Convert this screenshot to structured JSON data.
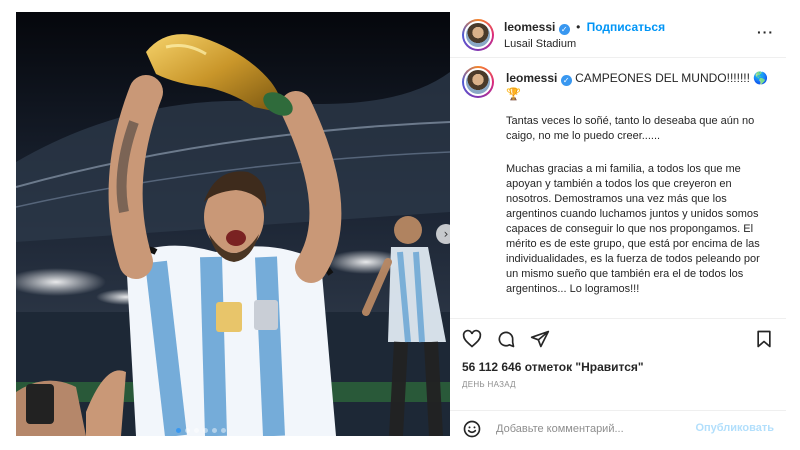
{
  "post": {
    "username": "leomessi",
    "follow_label": "Подписаться",
    "separator": "•",
    "location": "Lusail Stadium",
    "more_icon": "more-horizontal-icon",
    "verified_glyph": "✓"
  },
  "caption": {
    "username": "leomessi",
    "first_line": "CAMPEONES DEL MUNDO!!!!!!! 🌎🏆",
    "paragraph_1": "Tantas veces lo soñé, tanto lo deseaba que aún no caigo, no me lo puedo creer......",
    "paragraph_2": "Muchas gracias a mi familia, a todos los que me apoyan y también a todos los que creyeron en nosotros. Demostramos una vez más que los argentinos cuando luchamos juntos y unidos somos capaces de conseguir lo que nos propongamos. El mérito es de este grupo, que está por encima de las individualidades, es la fuerza de todos peleando por un mismo sueño que también era el de todos los argentinos... Lo logramos!!!"
  },
  "actions": {
    "like_icon": "heart-icon",
    "comment_icon": "comment-icon",
    "share_icon": "paper-plane-icon",
    "save_icon": "bookmark-icon"
  },
  "likes": "56 112 646 отметок \"Нравится\"",
  "time_ago": "ДЕНЬ НАЗАД",
  "comment": {
    "placeholder": "Добавьте комментарий...",
    "publish_label": "Опубликовать",
    "emoji_icon": "smile-icon"
  },
  "carousel": {
    "next_glyph": "›",
    "slides_count": 6,
    "active_index": 0
  },
  "colors": {
    "accent": "#0095f6",
    "verified": "#3897f0",
    "muted": "#8e8e8e",
    "publish_disabled": "#b2dffc"
  }
}
